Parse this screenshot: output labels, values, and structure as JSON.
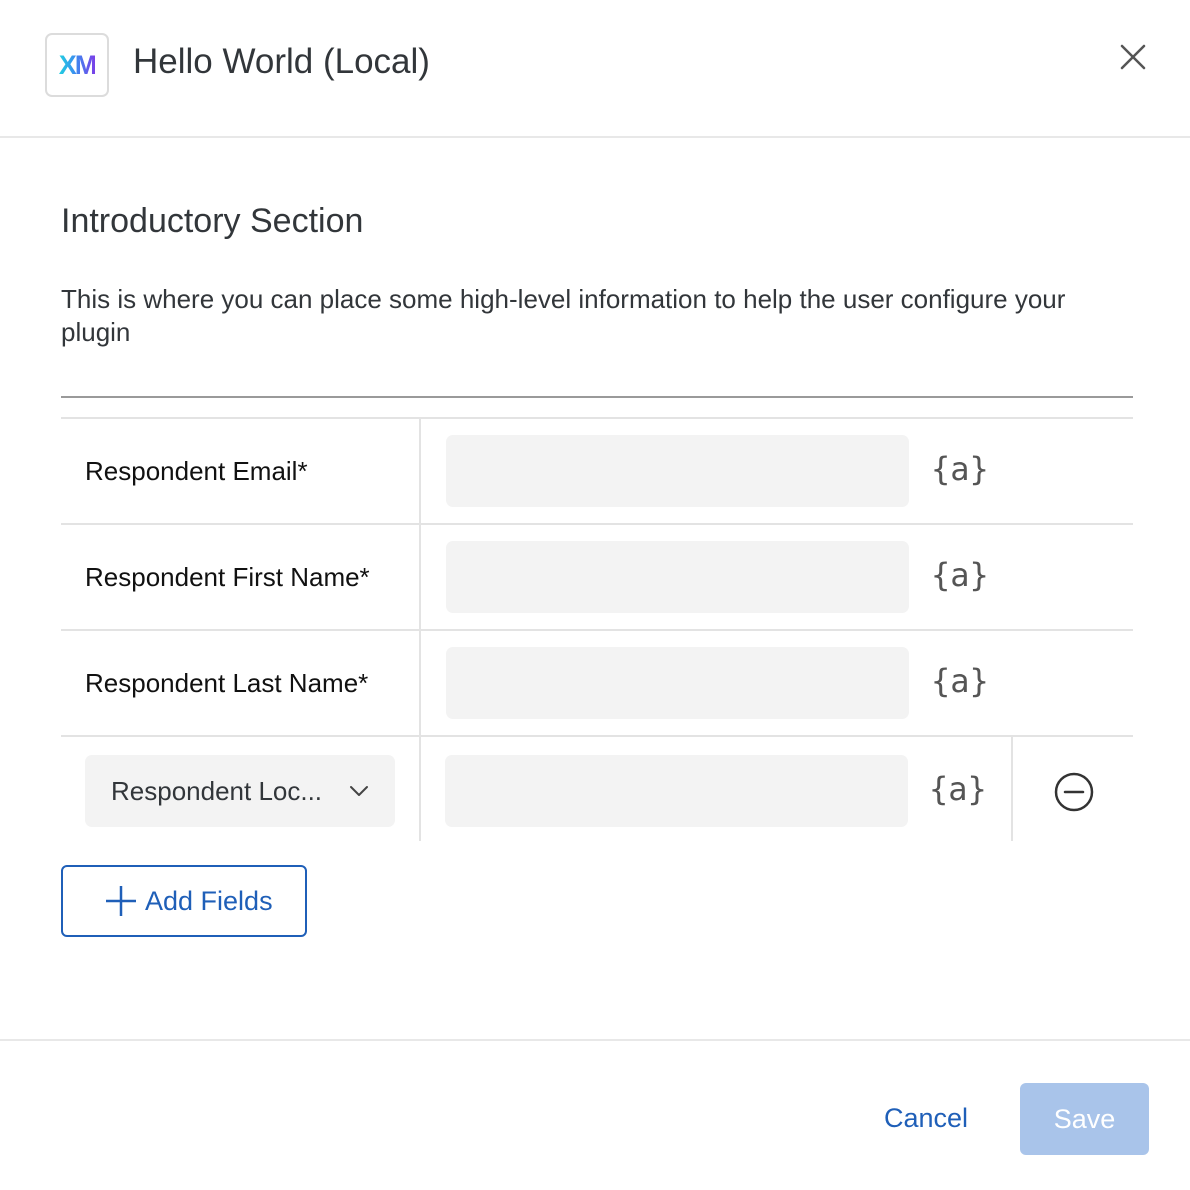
{
  "header": {
    "logo_text": "XM",
    "title": "Hello World (Local)"
  },
  "section": {
    "title": "Introductory Section",
    "description": "This is where you can place some high-level information to help the user configure your plugin"
  },
  "fields": [
    {
      "label": "Respondent Email*",
      "value": ""
    },
    {
      "label": "Respondent First Name*",
      "value": ""
    },
    {
      "label": "Respondent Last Name*",
      "value": ""
    }
  ],
  "custom_field": {
    "selected": "Respondent Loc...",
    "value": ""
  },
  "piped_text_label": "{a}",
  "add_fields_label": "Add Fields",
  "footer": {
    "cancel_label": "Cancel",
    "save_label": "Save"
  },
  "colors": {
    "accent": "#1f5fb8",
    "save_disabled": "#a9c4ea",
    "input_bg": "#f3f3f3"
  }
}
